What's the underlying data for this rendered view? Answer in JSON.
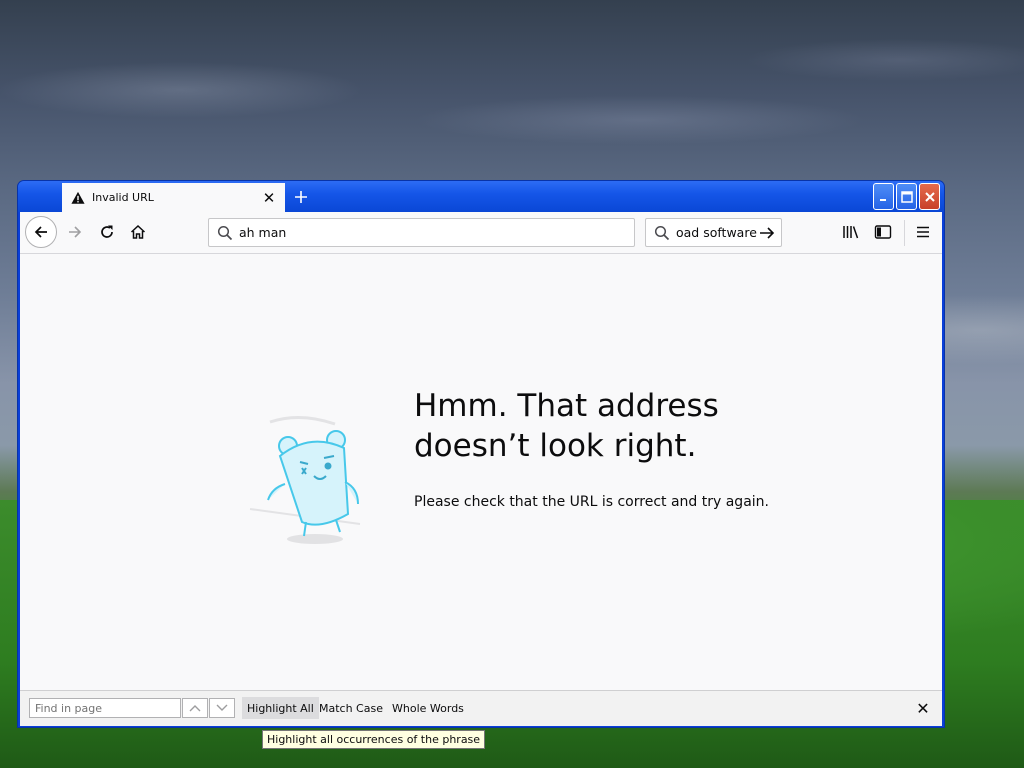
{
  "desktop": {
    "wallpaper": "hills"
  },
  "tab": {
    "title": "Invalid URL",
    "icon": "warning-icon"
  },
  "toolbar": {
    "url_value": "ah man",
    "search_value": "oad software"
  },
  "error": {
    "heading": "Hmm. That address doesn’t look right.",
    "message": "Please check that the URL is correct and try again."
  },
  "findbar": {
    "placeholder": "Find in page",
    "highlight_all": "Highlight All",
    "match_case": "Match Case",
    "whole_words": "Whole Words"
  },
  "tooltip": {
    "text": "Highlight all occurrences of the phrase"
  },
  "colors": {
    "titlebar": "#1556e8",
    "content_bg": "#f9f9fa",
    "illustration": "#47c8ea"
  }
}
